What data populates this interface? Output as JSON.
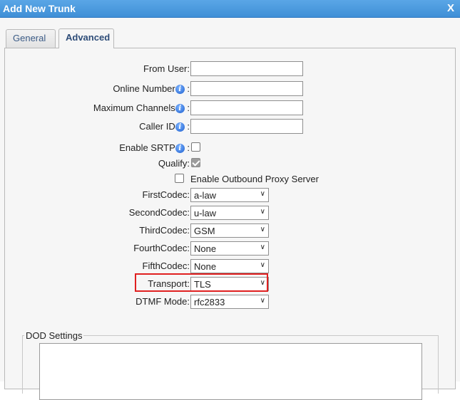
{
  "window": {
    "title": "Add New Trunk",
    "close_label": "X"
  },
  "tabs": [
    {
      "label": "General",
      "active": false
    },
    {
      "label": "Advanced",
      "active": true
    }
  ],
  "fields": {
    "from_user": {
      "label": "From User:",
      "value": ""
    },
    "online_number": {
      "label": "Online Number",
      "value": ""
    },
    "maximum_channels": {
      "label": "Maximum Channels",
      "value": ""
    },
    "caller_id": {
      "label": "Caller ID",
      "value": ""
    },
    "enable_srtp": {
      "label": "Enable SRTP",
      "checked": false
    },
    "qualify": {
      "label": "Qualify:",
      "checked": true
    },
    "outbound_proxy": {
      "label": "Enable Outbound Proxy Server",
      "checked": false
    },
    "first_codec": {
      "label": "FirstCodec:",
      "value": "a-law"
    },
    "second_codec": {
      "label": "SecondCodec:",
      "value": "u-law"
    },
    "third_codec": {
      "label": "ThirdCodec:",
      "value": "GSM"
    },
    "fourth_codec": {
      "label": "FourthCodec:",
      "value": "None"
    },
    "fifth_codec": {
      "label": "FifthCodec:",
      "value": "None"
    },
    "transport": {
      "label": "Transport:",
      "value": "TLS"
    },
    "dtmf_mode": {
      "label": "DTMF Mode:",
      "value": "rfc2833"
    }
  },
  "info_suffix": ":",
  "info_glyph": "i",
  "dod": {
    "legend": "DOD Settings"
  },
  "colors": {
    "titlebar": "#4a9be0",
    "highlight": "#e02020",
    "link_tab": "#3b5b86"
  }
}
